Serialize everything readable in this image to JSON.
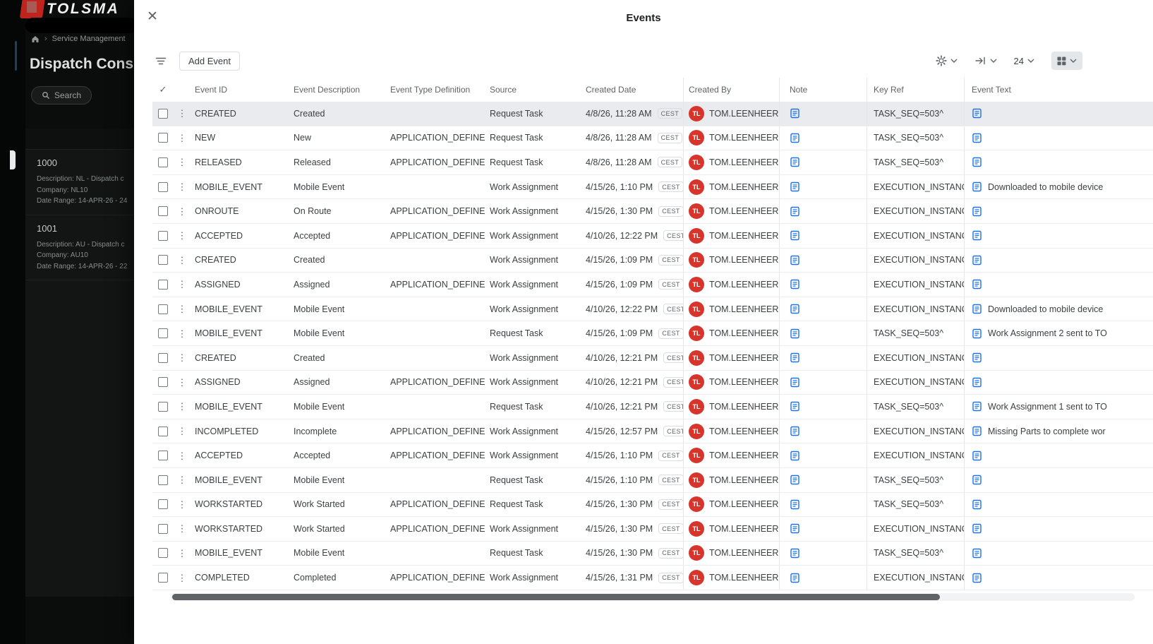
{
  "backdrop": {
    "logo_text": "TOLSMA",
    "breadcrumb_item": "Service Management",
    "page_title": "Dispatch Cons",
    "search_label": "Search",
    "cards": [
      {
        "id": "1000",
        "description": "Description:  NL - Dispatch c",
        "company": "Company:  NL10",
        "date_range": "Date Range:  14-APR-26 - 24"
      },
      {
        "id": "1001",
        "description": "Description:  AU - Dispatch c",
        "company": "Company:  AU10",
        "date_range": "Date Range:  14-APR-26 - 22"
      }
    ]
  },
  "modal": {
    "title": "Events",
    "close_label": "✕",
    "toolbar": {
      "add_event_label": "Add Event",
      "page_size": "24"
    },
    "table": {
      "columns": [
        "Event ID",
        "Event Description",
        "Event Type Definition",
        "Source",
        "Created Date",
        "Created By",
        "Note",
        "Key Ref",
        "Event Text"
      ],
      "rows": [
        {
          "selected": true,
          "event_id": "CREATED",
          "event_description": "Created",
          "event_type_definition": "",
          "source": "Request Task",
          "created_date": "4/8/26, 11:28 AM",
          "tz": "CEST",
          "avatar_initials": "TL",
          "created_by": "TOM.LEENHEER",
          "key_ref": "TASK_SEQ=503^",
          "event_text": ""
        },
        {
          "selected": false,
          "event_id": "NEW",
          "event_description": "New",
          "event_type_definition": "APPLICATION_DEFINED",
          "source": "Request Task",
          "created_date": "4/8/26, 11:28 AM",
          "tz": "CEST",
          "avatar_initials": "TL",
          "created_by": "TOM.LEENHEER",
          "key_ref": "TASK_SEQ=503^",
          "event_text": ""
        },
        {
          "selected": false,
          "event_id": "RELEASED",
          "event_description": "Released",
          "event_type_definition": "APPLICATION_DEFINED",
          "source": "Request Task",
          "created_date": "4/8/26, 11:28 AM",
          "tz": "CEST",
          "avatar_initials": "TL",
          "created_by": "TOM.LEENHEER",
          "key_ref": "TASK_SEQ=503^",
          "event_text": ""
        },
        {
          "selected": false,
          "event_id": "MOBILE_EVENT",
          "event_description": "Mobile Event",
          "event_type_definition": "",
          "source": "Work Assignment",
          "created_date": "4/15/26, 1:10 PM",
          "tz": "CEST",
          "avatar_initials": "TL",
          "created_by": "TOM.LEENHEER",
          "key_ref": "EXECUTION_INSTANC...",
          "event_text": "Downloaded to mobile device"
        },
        {
          "selected": false,
          "event_id": "ONROUTE",
          "event_description": "On Route",
          "event_type_definition": "APPLICATION_DEFINED",
          "source": "Work Assignment",
          "created_date": "4/15/26, 1:30 PM",
          "tz": "CEST",
          "avatar_initials": "TL",
          "created_by": "TOM.LEENHEER",
          "key_ref": "EXECUTION_INSTANC...",
          "event_text": ""
        },
        {
          "selected": false,
          "event_id": "ACCEPTED",
          "event_description": "Accepted",
          "event_type_definition": "APPLICATION_DEFINED",
          "source": "Work Assignment",
          "created_date": "4/10/26, 12:22 PM",
          "tz": "CEST",
          "avatar_initials": "TL",
          "created_by": "TOM.LEENHEER",
          "key_ref": "EXECUTION_INSTANC...",
          "event_text": ""
        },
        {
          "selected": false,
          "event_id": "CREATED",
          "event_description": "Created",
          "event_type_definition": "",
          "source": "Work Assignment",
          "created_date": "4/15/26, 1:09 PM",
          "tz": "CEST",
          "avatar_initials": "TL",
          "created_by": "TOM.LEENHEER",
          "key_ref": "EXECUTION_INSTANC...",
          "event_text": ""
        },
        {
          "selected": false,
          "event_id": "ASSIGNED",
          "event_description": "Assigned",
          "event_type_definition": "APPLICATION_DEFINED",
          "source": "Work Assignment",
          "created_date": "4/15/26, 1:09 PM",
          "tz": "CEST",
          "avatar_initials": "TL",
          "created_by": "TOM.LEENHEER",
          "key_ref": "EXECUTION_INSTANC...",
          "event_text": ""
        },
        {
          "selected": false,
          "event_id": "MOBILE_EVENT",
          "event_description": "Mobile Event",
          "event_type_definition": "",
          "source": "Work Assignment",
          "created_date": "4/10/26, 12:22 PM",
          "tz": "CEST",
          "avatar_initials": "TL",
          "created_by": "TOM.LEENHEER",
          "key_ref": "EXECUTION_INSTANC...",
          "event_text": "Downloaded to mobile device"
        },
        {
          "selected": false,
          "event_id": "MOBILE_EVENT",
          "event_description": "Mobile Event",
          "event_type_definition": "",
          "source": "Request Task",
          "created_date": "4/15/26, 1:09 PM",
          "tz": "CEST",
          "avatar_initials": "TL",
          "created_by": "TOM.LEENHEER",
          "key_ref": "TASK_SEQ=503^",
          "event_text": "Work Assignment 2 sent to TO"
        },
        {
          "selected": false,
          "event_id": "CREATED",
          "event_description": "Created",
          "event_type_definition": "",
          "source": "Work Assignment",
          "created_date": "4/10/26, 12:21 PM",
          "tz": "CEST",
          "avatar_initials": "TL",
          "created_by": "TOM.LEENHEER",
          "key_ref": "EXECUTION_INSTANC...",
          "event_text": ""
        },
        {
          "selected": false,
          "event_id": "ASSIGNED",
          "event_description": "Assigned",
          "event_type_definition": "APPLICATION_DEFINED",
          "source": "Work Assignment",
          "created_date": "4/10/26, 12:21 PM",
          "tz": "CEST",
          "avatar_initials": "TL",
          "created_by": "TOM.LEENHEER",
          "key_ref": "EXECUTION_INSTANC...",
          "event_text": ""
        },
        {
          "selected": false,
          "event_id": "MOBILE_EVENT",
          "event_description": "Mobile Event",
          "event_type_definition": "",
          "source": "Request Task",
          "created_date": "4/10/26, 12:21 PM",
          "tz": "CEST",
          "avatar_initials": "TL",
          "created_by": "TOM.LEENHEER",
          "key_ref": "TASK_SEQ=503^",
          "event_text": "Work Assignment 1 sent to TO"
        },
        {
          "selected": false,
          "event_id": "INCOMPLETED",
          "event_description": "Incomplete",
          "event_type_definition": "APPLICATION_DEFINED",
          "source": "Work Assignment",
          "created_date": "4/15/26, 12:57 PM",
          "tz": "CEST",
          "avatar_initials": "TL",
          "created_by": "TOM.LEENHEER",
          "key_ref": "EXECUTION_INSTANC...",
          "event_text": "Missing Parts to complete wor"
        },
        {
          "selected": false,
          "event_id": "ACCEPTED",
          "event_description": "Accepted",
          "event_type_definition": "APPLICATION_DEFINED",
          "source": "Work Assignment",
          "created_date": "4/15/26, 1:10 PM",
          "tz": "CEST",
          "avatar_initials": "TL",
          "created_by": "TOM.LEENHEER",
          "key_ref": "EXECUTION_INSTANC...",
          "event_text": ""
        },
        {
          "selected": false,
          "event_id": "MOBILE_EVENT",
          "event_description": "Mobile Event",
          "event_type_definition": "",
          "source": "Request Task",
          "created_date": "4/15/26, 1:10 PM",
          "tz": "CEST",
          "avatar_initials": "TL",
          "created_by": "TOM.LEENHEER",
          "key_ref": "TASK_SEQ=503^",
          "event_text": ""
        },
        {
          "selected": false,
          "event_id": "WORKSTARTED",
          "event_description": "Work Started",
          "event_type_definition": "APPLICATION_DEFINED",
          "source": "Request Task",
          "created_date": "4/15/26, 1:30 PM",
          "tz": "CEST",
          "avatar_initials": "TL",
          "created_by": "TOM.LEENHEER",
          "key_ref": "TASK_SEQ=503^",
          "event_text": ""
        },
        {
          "selected": false,
          "event_id": "WORKSTARTED",
          "event_description": "Work Started",
          "event_type_definition": "APPLICATION_DEFINED",
          "source": "Work Assignment",
          "created_date": "4/15/26, 1:30 PM",
          "tz": "CEST",
          "avatar_initials": "TL",
          "created_by": "TOM.LEENHEER",
          "key_ref": "EXECUTION_INSTANC...",
          "event_text": ""
        },
        {
          "selected": false,
          "event_id": "MOBILE_EVENT",
          "event_description": "Mobile Event",
          "event_type_definition": "",
          "source": "Request Task",
          "created_date": "4/15/26, 1:30 PM",
          "tz": "CEST",
          "avatar_initials": "TL",
          "created_by": "TOM.LEENHEER",
          "key_ref": "TASK_SEQ=503^",
          "event_text": ""
        },
        {
          "selected": false,
          "event_id": "COMPLETED",
          "event_description": "Completed",
          "event_type_definition": "APPLICATION_DEFINED",
          "source": "Work Assignment",
          "created_date": "4/15/26, 1:31 PM",
          "tz": "CEST",
          "avatar_initials": "TL",
          "created_by": "TOM.LEENHEER",
          "key_ref": "EXECUTION_INSTANC...",
          "event_text": ""
        }
      ]
    }
  },
  "colors": {
    "accent_blue": "#1a73e8",
    "avatar_red": "#d7342c",
    "selected_row": "#e9ebef"
  }
}
